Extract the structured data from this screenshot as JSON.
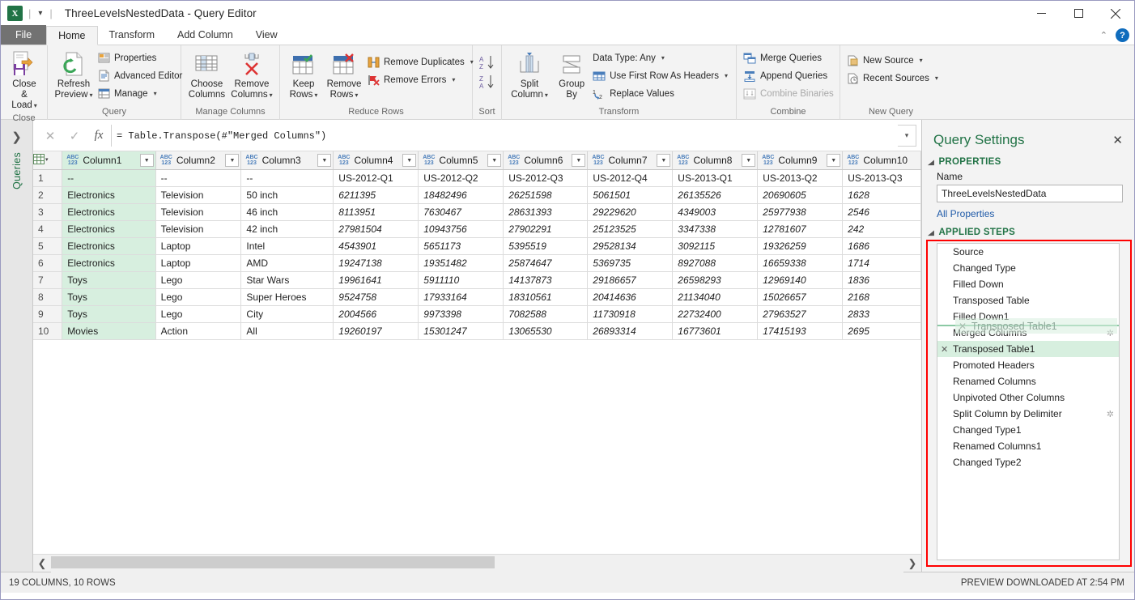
{
  "window": {
    "title": "ThreeLevelsNestedData - Query Editor",
    "app_logo": "excel-logo",
    "qat_dropdown": "▾",
    "minimize": "—",
    "maximize": "❐",
    "close": "✕"
  },
  "ribbon": {
    "tabs": [
      {
        "label": "File",
        "type": "file"
      },
      {
        "label": "Home",
        "active": true
      },
      {
        "label": "Transform"
      },
      {
        "label": "Add Column"
      },
      {
        "label": "View"
      }
    ],
    "collapse_caret": "⌃",
    "help_label": "?",
    "groups": [
      {
        "title": "Close",
        "big_buttons": [
          {
            "label_line1": "Close &",
            "label_line2": "Load",
            "caret": "▾",
            "icon": "close-and-load-icon"
          }
        ]
      },
      {
        "title": "Query",
        "big_buttons": [
          {
            "label_line1": "Refresh",
            "label_line2": "Preview",
            "caret": "▾",
            "icon": "refresh-preview-icon"
          }
        ],
        "small_buttons": [
          {
            "label": "Properties",
            "icon": "properties-icon",
            "caret": ""
          },
          {
            "label": "Advanced Editor",
            "icon": "advanced-editor-icon",
            "caret": ""
          },
          {
            "label": "Manage",
            "icon": "manage-icon",
            "caret": "▾"
          }
        ]
      },
      {
        "title": "Manage Columns",
        "big_buttons": [
          {
            "label_line1": "Choose",
            "label_line2": "Columns",
            "caret": "",
            "icon": "choose-columns-icon"
          },
          {
            "label_line1": "Remove",
            "label_line2": "Columns",
            "caret": "▾",
            "icon": "remove-columns-icon"
          }
        ]
      },
      {
        "title": "Reduce Rows",
        "big_buttons": [
          {
            "label_line1": "Keep",
            "label_line2": "Rows",
            "caret": "▾",
            "icon": "keep-rows-icon"
          },
          {
            "label_line1": "Remove",
            "label_line2": "Rows",
            "caret": "▾",
            "icon": "remove-rows-icon"
          }
        ],
        "small_buttons": [
          {
            "label": "Remove Duplicates",
            "icon": "remove-duplicates-icon",
            "caret": "▾"
          },
          {
            "label": "Remove Errors",
            "icon": "remove-errors-icon",
            "caret": "▾"
          }
        ]
      },
      {
        "title": "Sort",
        "small_buttons": [
          {
            "label": "",
            "icon": "sort-ascending-icon",
            "caret": ""
          },
          {
            "label": "",
            "icon": "sort-descending-icon",
            "caret": ""
          }
        ]
      },
      {
        "title": "Transform",
        "big_buttons": [
          {
            "label_line1": "Split",
            "label_line2": "Column",
            "caret": "▾",
            "icon": "split-column-icon"
          },
          {
            "label_line1": "Group",
            "label_line2": "By",
            "caret": "",
            "icon": "group-by-icon"
          }
        ],
        "small_buttons": [
          {
            "label": "Data Type: Any",
            "icon": "",
            "caret": "▾"
          },
          {
            "label": "Use First Row As Headers",
            "icon": "use-first-row-as-headers-icon",
            "caret": "▾"
          },
          {
            "label": "Replace Values",
            "icon": "replace-values-icon",
            "caret": ""
          }
        ]
      },
      {
        "title": "Combine",
        "small_buttons": [
          {
            "label": "Merge Queries",
            "icon": "merge-queries-icon",
            "caret": ""
          },
          {
            "label": "Append Queries",
            "icon": "append-queries-icon",
            "caret": ""
          },
          {
            "label": "Combine Binaries",
            "icon": "combine-binaries-icon",
            "caret": "",
            "disabled": true
          }
        ]
      },
      {
        "title": "New Query",
        "small_buttons": [
          {
            "label": "New Source",
            "icon": "new-source-icon",
            "caret": "▾"
          },
          {
            "label": "Recent Sources",
            "icon": "recent-sources-icon",
            "caret": "▾"
          }
        ]
      }
    ]
  },
  "queries_pane": {
    "expand_icon": "❯",
    "label": "Queries"
  },
  "formula_bar": {
    "cancel_icon": "✕",
    "accept_icon": "✓",
    "fx_icon": "fx",
    "value": "= Table.Transpose(#\"Merged Columns\")",
    "expand_caret": "▾"
  },
  "grid": {
    "type_badge": "ABC\n123",
    "table_icon": "table-icon",
    "columns": [
      {
        "name": "Column1",
        "width": 120,
        "selected": true,
        "align": "left"
      },
      {
        "name": "Column2",
        "width": 108,
        "selected": false,
        "align": "left"
      },
      {
        "name": "Column3",
        "width": 118,
        "selected": false,
        "align": "left"
      },
      {
        "name": "Column4",
        "width": 107,
        "selected": false,
        "align": "right"
      },
      {
        "name": "Column5",
        "width": 107,
        "selected": false,
        "align": "right"
      },
      {
        "name": "Column6",
        "width": 106,
        "selected": false,
        "align": "right"
      },
      {
        "name": "Column7",
        "width": 107,
        "selected": false,
        "align": "right"
      },
      {
        "name": "Column8",
        "width": 107,
        "selected": false,
        "align": "right"
      },
      {
        "name": "Column9",
        "width": 107,
        "selected": false,
        "align": "right"
      },
      {
        "name": "Column10",
        "width": 100,
        "selected": false,
        "align": "right"
      }
    ],
    "rows": [
      {
        "n": "1",
        "cells": [
          "--",
          "--",
          "--",
          "US-2012-Q1",
          "US-2012-Q2",
          "US-2012-Q3",
          "US-2012-Q4",
          "US-2013-Q1",
          "US-2013-Q2",
          "US-2013-Q3"
        ],
        "header_row": true
      },
      {
        "n": "2",
        "cells": [
          "Electronics",
          "Television",
          "50 inch",
          "6211395",
          "18482496",
          "26251598",
          "5061501",
          "26135526",
          "20690605",
          "1628"
        ]
      },
      {
        "n": "3",
        "cells": [
          "Electronics",
          "Television",
          "46 inch",
          "8113951",
          "7630467",
          "28631393",
          "29229620",
          "4349003",
          "25977938",
          "2546"
        ]
      },
      {
        "n": "4",
        "cells": [
          "Electronics",
          "Television",
          "42 inch",
          "27981504",
          "10943756",
          "27902291",
          "25123525",
          "3347338",
          "12781607",
          "242"
        ]
      },
      {
        "n": "5",
        "cells": [
          "Electronics",
          "Laptop",
          "Intel",
          "4543901",
          "5651173",
          "5395519",
          "29528134",
          "3092115",
          "19326259",
          "1686"
        ]
      },
      {
        "n": "6",
        "cells": [
          "Electronics",
          "Laptop",
          "AMD",
          "19247138",
          "19351482",
          "25874647",
          "5369735",
          "8927088",
          "16659338",
          "1714"
        ]
      },
      {
        "n": "7",
        "cells": [
          "Toys",
          "Lego",
          "Star Wars",
          "19961641",
          "5911110",
          "14137873",
          "29186657",
          "26598293",
          "12969140",
          "1836"
        ]
      },
      {
        "n": "8",
        "cells": [
          "Toys",
          "Lego",
          "Super Heroes",
          "9524758",
          "17933164",
          "18310561",
          "20414636",
          "21134040",
          "15026657",
          "2168"
        ]
      },
      {
        "n": "9",
        "cells": [
          "Toys",
          "Lego",
          "City",
          "2004566",
          "9973398",
          "7082588",
          "11730918",
          "22732400",
          "27963527",
          "2833"
        ]
      },
      {
        "n": "10",
        "cells": [
          "Movies",
          "Action",
          "All",
          "19260197",
          "15301247",
          "13065530",
          "26893314",
          "16773601",
          "17415193",
          "2695"
        ]
      }
    ],
    "scroll_left_icon": "❮",
    "scroll_right_icon": "❯"
  },
  "query_settings": {
    "title": "Query Settings",
    "close_icon": "✕",
    "properties": {
      "section_label": "PROPERTIES",
      "name_label": "Name",
      "name_value": "ThreeLevelsNestedData",
      "all_properties_link": "All Properties"
    },
    "applied_steps": {
      "section_label": "APPLIED STEPS",
      "steps": [
        {
          "label": "Source",
          "x": false,
          "gear": false
        },
        {
          "label": "Changed Type",
          "x": false,
          "gear": false
        },
        {
          "label": "Filled Down",
          "x": false,
          "gear": false
        },
        {
          "label": "Transposed Table",
          "x": false,
          "gear": false
        },
        {
          "label": "Filled Down1",
          "x": false,
          "gear": false
        },
        {
          "label": "Merged Columns",
          "x": false,
          "gear": true
        },
        {
          "label": "Transposed Table1",
          "x": true,
          "gear": false,
          "active": true
        },
        {
          "label": "Promoted Headers",
          "x": false,
          "gear": false
        },
        {
          "label": "Renamed Columns",
          "x": false,
          "gear": false
        },
        {
          "label": "Unpivoted Other Columns",
          "x": false,
          "gear": false
        },
        {
          "label": "Split Column by Delimiter",
          "x": false,
          "gear": true
        },
        {
          "label": "Changed Type1",
          "x": false,
          "gear": false
        },
        {
          "label": "Renamed Columns1",
          "x": false,
          "gear": false
        },
        {
          "label": "Changed Type2",
          "x": false,
          "gear": false
        }
      ],
      "drag_ghost_label": "Transposed Table1",
      "drag_ghost_x": "✕"
    }
  },
  "status_bar": {
    "left": "19 COLUMNS, 10 ROWS",
    "right": "PREVIEW DOWNLOADED AT 2:54 PM"
  },
  "colors": {
    "accent_green": "#217346",
    "selection_green": "#d7efdf",
    "highlight_red": "#ff0000",
    "link_blue": "#1f5aa8"
  }
}
